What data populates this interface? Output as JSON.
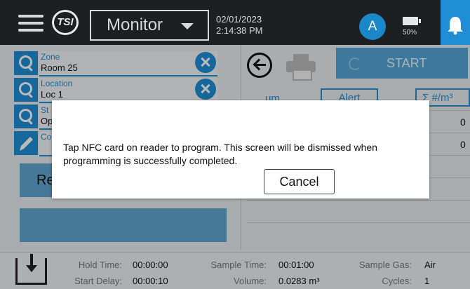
{
  "header": {
    "logo_text": "TSI",
    "mode": "Monitor",
    "date": "02/01/2023",
    "time": "2:14:38 PM",
    "user_initial": "A",
    "battery_percent": "50%"
  },
  "fields": [
    {
      "label": "Zone",
      "value": "Room 25",
      "icon": "search-icon"
    },
    {
      "label": "Location",
      "value": "Loc 1",
      "icon": "search-icon"
    },
    {
      "label": "St",
      "value": "Op",
      "icon": "search-icon"
    },
    {
      "label": "Co",
      "value": "",
      "icon": "pencil-icon"
    }
  ],
  "left_button_1_label": "Re",
  "controls": {
    "start_label": "START",
    "unit_label": "um",
    "alert_label": "Alert",
    "sum_label": "Σ #/m³",
    "row_values": [
      "0",
      "0"
    ]
  },
  "footer": {
    "hold_time_label": "Hold Time:",
    "hold_time": "00:00:00",
    "start_delay_label": "Start Delay:",
    "start_delay": "00:00:10",
    "sample_time_label": "Sample Time:",
    "sample_time": "00:01:00",
    "volume_label": "Volume:",
    "volume": "0.0283 m³",
    "sample_gas_label": "Sample Gas:",
    "sample_gas": "Air",
    "cycles_label": "Cycles:",
    "cycles": "1"
  },
  "dialog": {
    "message": "Tap NFC card on reader to program. This screen will be dismissed when programming is successfully completed.",
    "cancel_label": "Cancel"
  },
  "colors": {
    "accent": "#1f8ed6",
    "header_bg": "#1d1f21",
    "start_button": "#55a7d7",
    "left_button": "#61a7cf"
  }
}
